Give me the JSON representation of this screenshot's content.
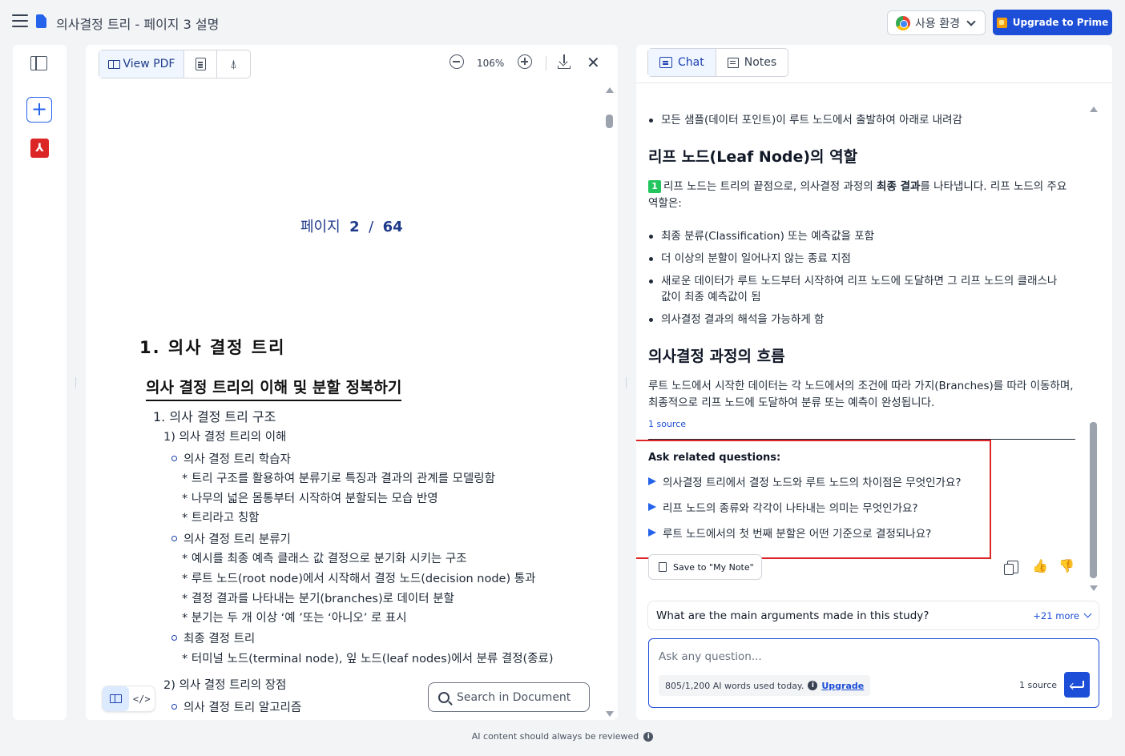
{
  "app": {
    "doc_title": "의사결정 트리 - 페이지 3 설명",
    "env_label": "사용 환경",
    "upgrade_label": "Upgrade to Prime"
  },
  "rail": {
    "add_label": "+",
    "pdf_label": "⅄"
  },
  "pdf": {
    "view_pdf_label": "View PDF",
    "zoom_level": "106%",
    "close_label": "✕",
    "page_label": "페이지",
    "page_current": "2",
    "page_sep": "/",
    "page_total": "64",
    "heading1": "1. 의사 결정 트리",
    "heading2": "의사 결정 트리의 이해 및 분할 정복하기",
    "lines": [
      "1. 의사 결정 트리 구조",
      "1) 의사 결정 트리의 이해",
      "의사 결정 트리 학습자",
      "* 트리 구조를 활용하여 분류기로 특징과 결과의 관계를 모델링함",
      "* 나무의 넓은 몸통부터 시작하여 분할되는 모습 반영",
      "* 트리라고 칭함",
      "의사 결정 트리 분류기",
      "* 예시를 최종 예측 클래스 값 결정으로 분기화 시키는 구조",
      "* 루트 노드(root node)에서 시작해서 결정 노드(decision node) 통과",
      "* 결정 결과를 나타내는 분기(branches)로 데이터 분할",
      "* 분기는 두 개 이상 ‘예 ’또는 ‘아니오’ 로 표시",
      "최종 결정 트리",
      "* 터미널 노드(terminal node), 잎 노드(leaf nodes)에서 분류 결정(종료)",
      "2) 의사 결정 트리의 장점",
      "의사 결정 트리 알고리즘"
    ],
    "search_placeholder": "Search in Document",
    "code_label": "</>"
  },
  "chat": {
    "tab_chat": "Chat",
    "tab_notes": "Notes",
    "top_bullet": "모든 샘플(데이터 포인트)이 루트 노드에서 출발하여 아래로 내려감",
    "section1_title": "리프 노드(Leaf Node)의 역할",
    "ref_num": "1",
    "para1_a": "리프 노드는 트리의 끝점으로, 의사결정 과정의 ",
    "para1_bold": "최종 결과",
    "para1_b": "를 나타냅니다. 리프 노드의 주요 역할은:",
    "bullets": [
      "최종 분류(Classification) 또는 예측값을 포함",
      "더 이상의 분할이 일어나지 않는 종료 지점",
      "새로운 데이터가 루트 노드부터 시작하여 리프 노드에 도달하면 그 리프 노드의 클래스나 값이 최종 예측값이 됨",
      "의사결정 결과의 해석을 가능하게 함"
    ],
    "section2_title": "의사결정 과정의 흐름",
    "para2": "루트 노드에서 시작한 데이터는 각 노드에서의 조건에 따라 가지(Branches)를 따라 이동하며, 최종적으로 리프 노드에 도달하여 분류 또는 예측이 완성됩니다.",
    "source_link": "1 source",
    "related_title": "Ask related questions:",
    "related": [
      "의사결정 트리에서 결정 노드와 루트 노드의 차이점은 무엇인가요?",
      "리프 노드의 종류와 각각이 나타내는 의미는 무엇인가요?",
      "루트 노드에서의 첫 번째 분할은 어떤 기준으로 결정되나요?"
    ],
    "save_note_label": "Save to \"My Note\"",
    "thumb_up": "👍",
    "thumb_down": "👎",
    "suggest_question": "What are the main arguments made in this study?",
    "suggest_more": "+21 more",
    "ask_placeholder": "Ask any question...",
    "usage_text": "805/1,200 AI words used today.",
    "usage_info": "i",
    "usage_upgrade": "Upgrade",
    "ask_source": "1 source"
  },
  "footer": {
    "note": "AI content should always be reviewed",
    "info": "i"
  }
}
